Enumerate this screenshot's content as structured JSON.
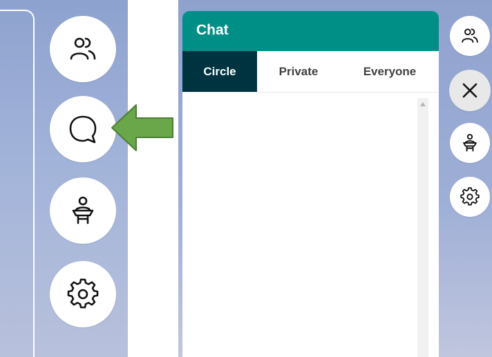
{
  "chat": {
    "title": "Chat",
    "tabs": [
      {
        "label": "Circle",
        "active": true
      },
      {
        "label": "Private",
        "active": false
      },
      {
        "label": "Everyone",
        "active": false
      }
    ]
  },
  "left_sidebar": {
    "items": [
      {
        "icon": "people-icon"
      },
      {
        "icon": "chat-bubble-icon"
      },
      {
        "icon": "presenter-icon"
      },
      {
        "icon": "gear-icon"
      }
    ]
  },
  "right_sidebar": {
    "items": [
      {
        "icon": "people-icon"
      },
      {
        "icon": "close-icon"
      },
      {
        "icon": "presenter-icon"
      },
      {
        "icon": "gear-icon"
      }
    ]
  },
  "annotation": {
    "icon": "green-arrow-left",
    "color": "#6aa64a"
  },
  "colors": {
    "header": "#008f87",
    "active_tab": "#003340",
    "background": "#97a9d3"
  }
}
